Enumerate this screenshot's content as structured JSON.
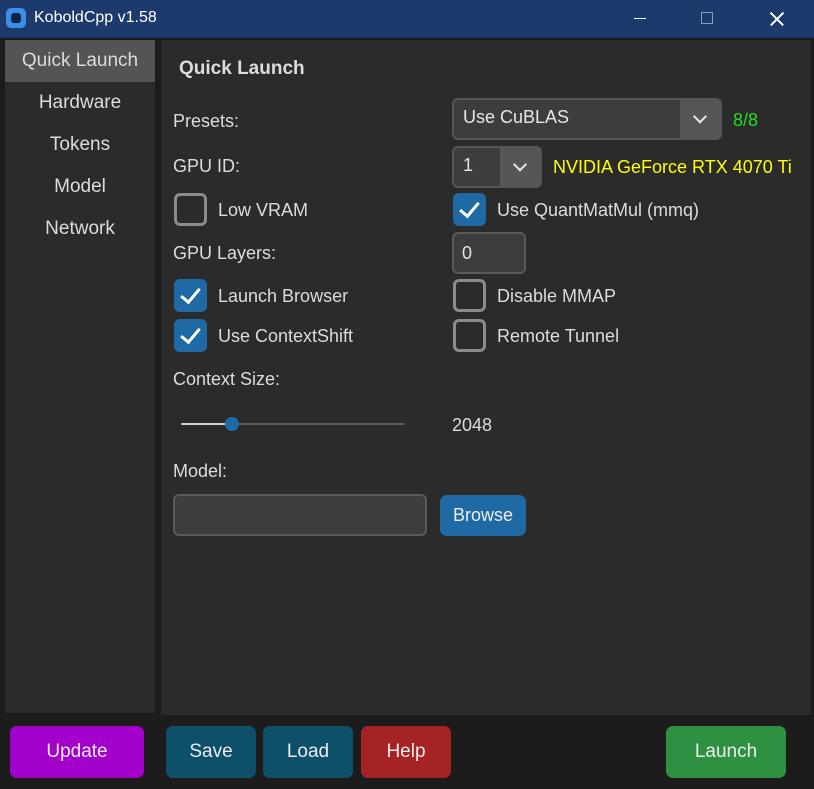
{
  "window": {
    "title": "KoboldCpp v1.58"
  },
  "sidebar": {
    "items": [
      {
        "label": "Quick Launch"
      },
      {
        "label": "Hardware"
      },
      {
        "label": "Tokens"
      },
      {
        "label": "Model"
      },
      {
        "label": "Network"
      }
    ],
    "active": "Quick Launch"
  },
  "main": {
    "heading": "Quick Launch",
    "presets": {
      "label": "Presets:",
      "value": "Use CuBLAS",
      "count": "8/8",
      "count_color": "#22dd22"
    },
    "gpu_id": {
      "label": "GPU ID:",
      "value": "1",
      "gpu_name": "NVIDIA GeForce RTX 4070 Ti",
      "gpu_name_color": "#ffff00"
    },
    "checkboxes": {
      "low_vram": {
        "label": "Low VRAM",
        "checked": false
      },
      "mmq": {
        "label": "Use QuantMatMul (mmq)",
        "checked": true
      },
      "launch_browser": {
        "label": "Launch Browser",
        "checked": true
      },
      "disable_mmap": {
        "label": "Disable MMAP",
        "checked": false
      },
      "context_shift": {
        "label": "Use ContextShift",
        "checked": true
      },
      "remote_tunnel": {
        "label": "Remote Tunnel",
        "checked": false
      }
    },
    "gpu_layers": {
      "label": "GPU Layers:",
      "value": "0"
    },
    "context_size": {
      "label": "Context Size:",
      "value": "2048"
    },
    "model": {
      "label": "Model:",
      "value": "",
      "browse_label": "Browse"
    }
  },
  "footer": {
    "update": "Update",
    "save": "Save",
    "load": "Load",
    "help": "Help",
    "launch": "Launch"
  },
  "colors": {
    "accent": "#1f6aa5",
    "update": "#a400cc",
    "save_load": "#0e4f69",
    "help": "#a52323",
    "launch": "#2e9141"
  }
}
